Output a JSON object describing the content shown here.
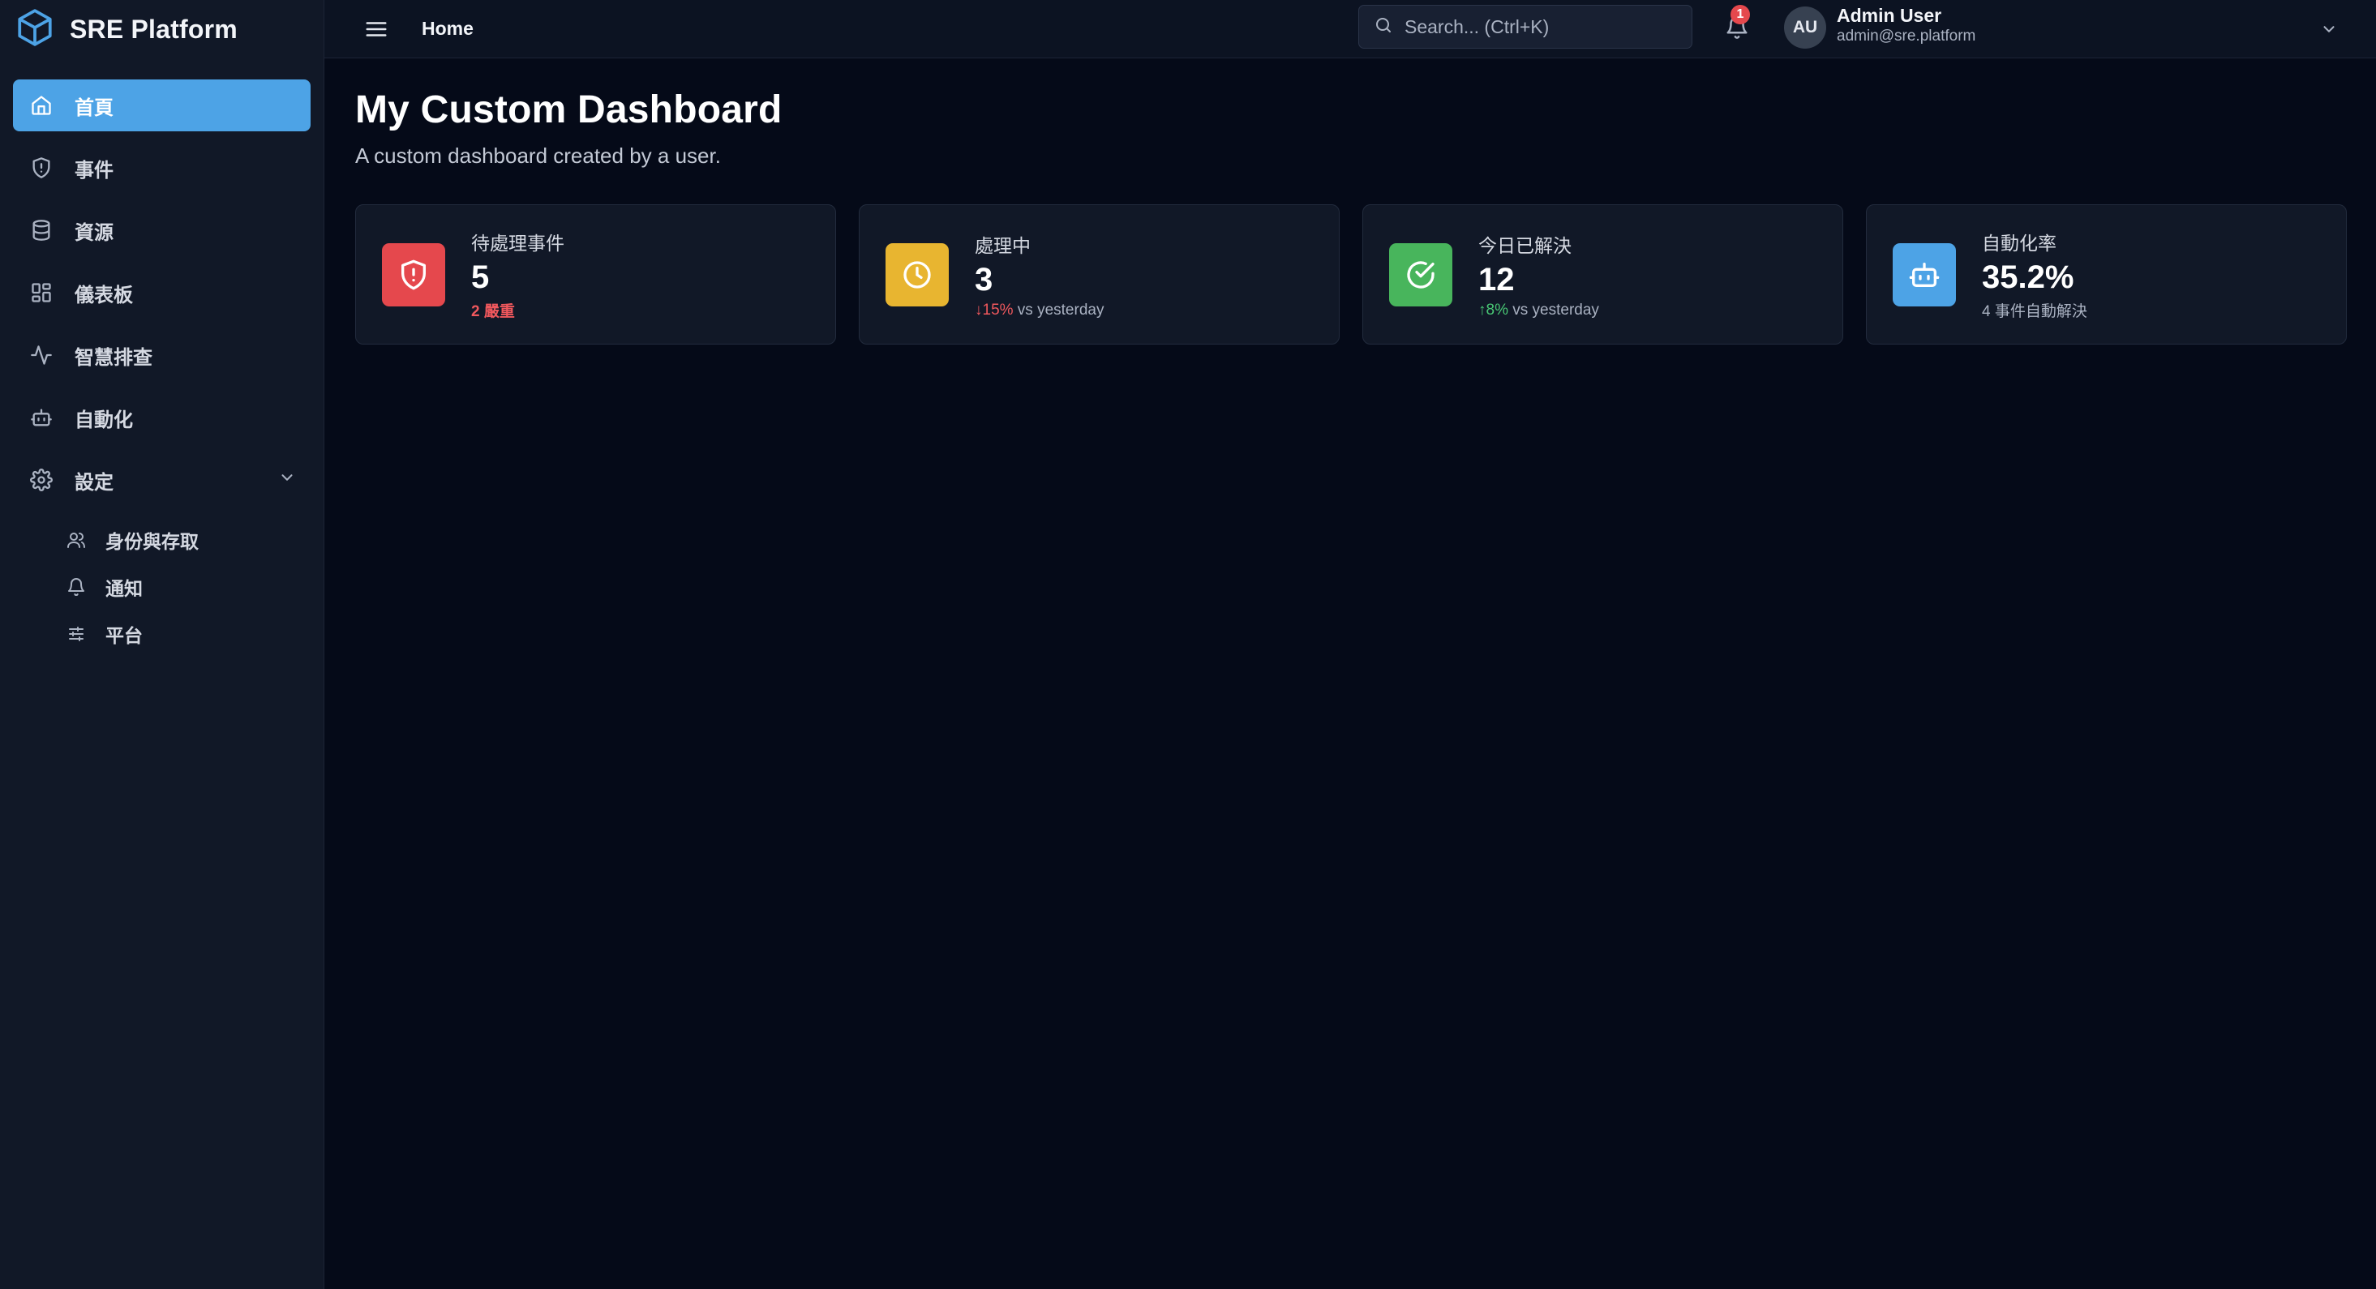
{
  "brand": {
    "name": "SRE Platform",
    "accent": "#4da3e6"
  },
  "sidebar": {
    "items": [
      {
        "label": "首頁",
        "icon": "home-icon",
        "active": true
      },
      {
        "label": "事件",
        "icon": "shield-alert-icon",
        "active": false
      },
      {
        "label": "資源",
        "icon": "database-icon",
        "active": false
      },
      {
        "label": "儀表板",
        "icon": "grid-icon",
        "active": false
      },
      {
        "label": "智慧排查",
        "icon": "activity-icon",
        "active": false
      },
      {
        "label": "自動化",
        "icon": "robot-icon",
        "active": false
      },
      {
        "label": "設定",
        "icon": "gear-icon",
        "active": false,
        "expanded": true
      }
    ],
    "settings_sub": [
      {
        "label": "身份與存取",
        "icon": "users-icon"
      },
      {
        "label": "通知",
        "icon": "bell-icon"
      },
      {
        "label": "平台",
        "icon": "sliders-icon"
      }
    ]
  },
  "topbar": {
    "breadcrumb": "Home",
    "search_placeholder": "Search... (Ctrl+K)",
    "notification_count": "1",
    "user": {
      "initials": "AU",
      "name": "Admin User",
      "email": "admin@sre.platform"
    }
  },
  "main": {
    "title": "My Custom Dashboard",
    "subtitle": "A custom dashboard created by a user."
  },
  "cards": [
    {
      "label": "待處理事件",
      "value": "5",
      "foot_highlight": "2 嚴重",
      "foot_rest": "",
      "icon": "shield-alert-icon",
      "color": "#e5484d"
    },
    {
      "label": "處理中",
      "value": "3",
      "foot_highlight": "↓15%",
      "foot_rest": " vs yesterday",
      "icon": "clock-icon",
      "color": "#e8b530"
    },
    {
      "label": "今日已解決",
      "value": "12",
      "foot_highlight": "↑8%",
      "foot_rest": " vs yesterday",
      "icon": "check-circle-icon",
      "color": "#48b55c"
    },
    {
      "label": "自動化率",
      "value": "35.2%",
      "foot_highlight": "",
      "foot_rest": "4 事件自動解決",
      "icon": "robot-icon",
      "color": "#4da3e6"
    }
  ]
}
